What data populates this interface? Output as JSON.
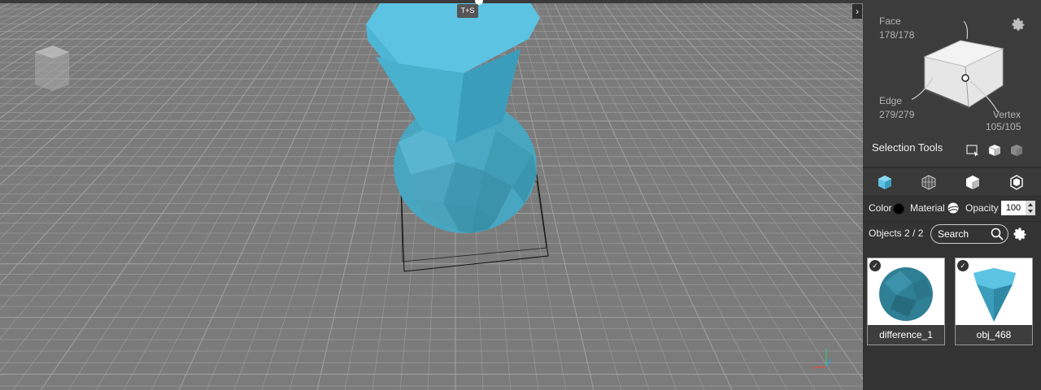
{
  "viewport": {
    "hotkey_badge": "T+S"
  },
  "selection_info": {
    "face_label": "Face",
    "face_count": "178/178",
    "edge_label": "Edge",
    "edge_count": "279/279",
    "vertex_label": "Vertex",
    "vertex_count": "105/105"
  },
  "selection_tools": {
    "label": "Selection Tools",
    "tools": [
      "box-select-icon",
      "select-through-icon",
      "select-visible-icon"
    ]
  },
  "mode_tabs": [
    "solid-mode-icon",
    "mesh-mode-icon",
    "shaded-mode-icon",
    "wireframe-mode-icon"
  ],
  "properties": {
    "color_label": "Color",
    "color_value": "#000000",
    "material_label": "Material",
    "opacity_label": "Opacity",
    "opacity_value": "100"
  },
  "objects": {
    "label": "Objects 2 / 2",
    "search_placeholder": "Search",
    "items": [
      {
        "name": "difference_1",
        "checked": true,
        "icon": "sphere-thumbnail"
      },
      {
        "name": "obj_468",
        "checked": true,
        "icon": "cone-thumbnail"
      }
    ]
  },
  "colors": {
    "accent": "#3fb3d6",
    "viewport_bg": "#7b7b7b",
    "panel_bg": "#333333"
  }
}
